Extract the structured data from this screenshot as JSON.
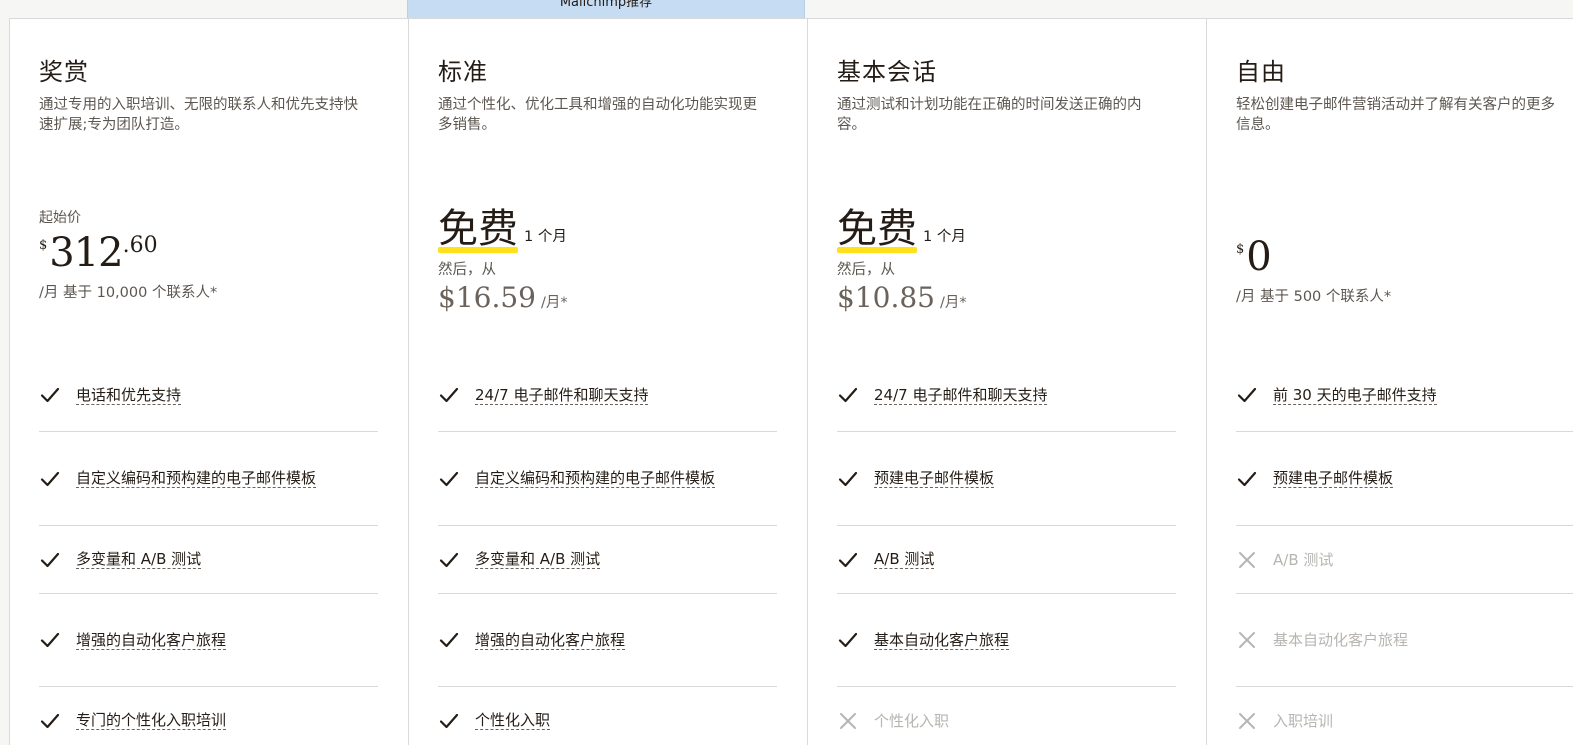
{
  "banner": {
    "label": "Mailchimp推荐"
  },
  "plans": [
    {
      "name": "奖赏",
      "description": "通过专用的入职培训、无限的联系人和优先支持快速扩展;专为团队打造。",
      "starting_label": "起始价",
      "currency": "$",
      "price_int": "312",
      "price_dec": ".60",
      "price_note": "/月 基于 10,000 个联系人*",
      "features": [
        {
          "text": "电话和优先支持",
          "included": true
        },
        {
          "text": "自定义编码和预构建的电子邮件模板",
          "included": true
        },
        {
          "text": "多变量和 A/B 测试",
          "included": true
        },
        {
          "text": "增强的自动化客户旅程",
          "included": true
        },
        {
          "text": "专门的个性化入职培训",
          "included": true
        }
      ]
    },
    {
      "name": "标准",
      "description": "通过个性化、优化工具和增强的自动化功能实现更多销售。",
      "free_word": "免费",
      "free_period": "1 个月",
      "then_label": "然后，从",
      "then_amount": "$16.59",
      "then_period": "/月*",
      "features": [
        {
          "text": "24/7 电子邮件和聊天支持",
          "included": true
        },
        {
          "text": "自定义编码和预构建的电子邮件模板",
          "included": true
        },
        {
          "text": "多变量和 A/B 测试",
          "included": true
        },
        {
          "text": "增强的自动化客户旅程",
          "included": true
        },
        {
          "text": "个性化入职",
          "included": true
        }
      ]
    },
    {
      "name": "基本会话",
      "description": "通过测试和计划功能在正确的时间发送正确的内容。",
      "free_word": "免费",
      "free_period": "1 个月",
      "then_label": "然后，从",
      "then_amount": "$10.85",
      "then_period": "/月*",
      "features": [
        {
          "text": "24/7 电子邮件和聊天支持",
          "included": true
        },
        {
          "text": "预建电子邮件模板",
          "included": true
        },
        {
          "text": "A/B 测试",
          "included": true
        },
        {
          "text": "基本自动化客户旅程",
          "included": true
        },
        {
          "text": "个性化入职",
          "included": false
        }
      ]
    },
    {
      "name": "自由",
      "description": "轻松创建电子邮件营销活动并了解有关客户的更多信息。",
      "currency": "$",
      "price_int": "0",
      "price_note": "/月 基于 500 个联系人*",
      "features": [
        {
          "text": "前 30 天的电子邮件支持",
          "included": true
        },
        {
          "text": "预建电子邮件模板",
          "included": true
        },
        {
          "text": "A/B 测试",
          "included": false
        },
        {
          "text": "基本自动化客户旅程",
          "included": false
        },
        {
          "text": "入职培训",
          "included": false
        }
      ]
    }
  ],
  "colors": {
    "highlight": "#ffe01b",
    "banner": "#c5dcf3",
    "check": "#241c15",
    "cross": "#b8b5b1"
  }
}
